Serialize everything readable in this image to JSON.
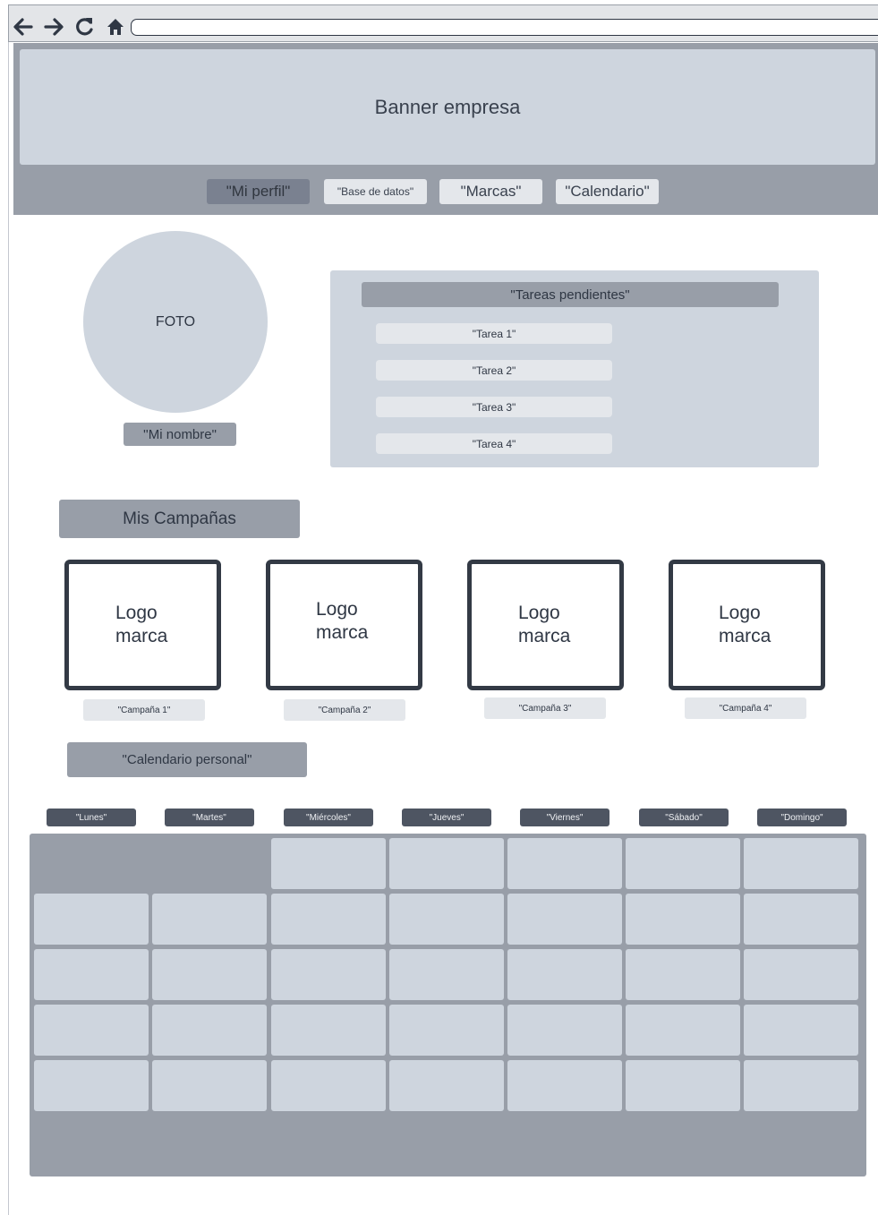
{
  "browser": {
    "icons": [
      "back-arrow-icon",
      "forward-arrow-icon",
      "reload-icon",
      "home-icon"
    ],
    "address": ""
  },
  "header": {
    "banner": "Banner empresa",
    "nav": [
      "\"Mi perfil\"",
      "\"Base de datos\"",
      "\"Marcas\"",
      "\"Calendario\""
    ],
    "active_index": 0
  },
  "profile": {
    "photo": "FOTO",
    "name": "''Mi nombre\""
  },
  "tasks": {
    "title": "\"Tareas pendientes\"",
    "items": [
      "\"Tarea 1\"",
      "\"Tarea 2\"",
      "\"Tarea 3\"",
      "\"Tarea 4\""
    ]
  },
  "campaigns": {
    "title": "Mis Campañas",
    "logo_line1": "Logo",
    "logo_line2": "marca",
    "items": [
      "\"Campaña 1\"",
      "\"Campaña 2\"",
      "\"Campaña 3\"",
      "\"Campaña 4\""
    ]
  },
  "calendar": {
    "title": "\"Calendario personal\"",
    "days": [
      "\"Lunes\"",
      "\"Martes\"",
      "\"Miércoles\"",
      "\"Jueves\"",
      "\"Viernes\"",
      "\"Sábado\"",
      "\"Domingo\""
    ],
    "first_weekday_index": 2,
    "days_in_month": 33
  },
  "colors": {
    "frame": "#989ea8",
    "panel": "#ced5de",
    "light": "#e4e7eb",
    "dark": "#4e5562",
    "active": "#7a8190"
  }
}
